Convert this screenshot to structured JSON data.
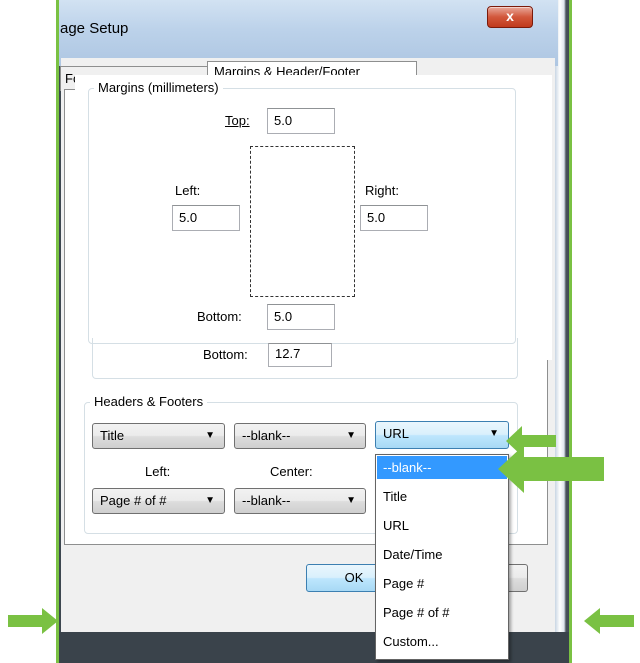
{
  "dialog": {
    "title": "age Setup",
    "close_glyph": "x"
  },
  "tabs": {
    "format_label": "Fo",
    "margins_label": "Margins & Header/Footer"
  },
  "margins": {
    "legend": "Margins (millimeters)",
    "top_label": "Top:",
    "top_value": "5.0",
    "left_label": "Left:",
    "left_value": "5.0",
    "right_label": "Right:",
    "right_value": "5.0",
    "bottom_label": "Bottom:",
    "bottom_value": "5.0",
    "bottom2_label": "Bottom:",
    "bottom2_value": "12.7"
  },
  "headers_footers": {
    "legend": "Headers & Footers",
    "header_left": "Title",
    "header_center": "--blank--",
    "header_right": "URL",
    "left_caption": "Left:",
    "center_caption": "Center:",
    "footer_left": "Page # of #",
    "footer_center": "--blank--"
  },
  "dropdown": {
    "options": [
      "--blank--",
      "Title",
      "URL",
      "Date/Time",
      "Page #",
      "Page # of #",
      "Custom..."
    ],
    "selected_index": 0
  },
  "buttons": {
    "ok_label": "OK"
  },
  "colors": {
    "highlight": "#3399ff",
    "annotation_arrow": "#7ac143"
  }
}
